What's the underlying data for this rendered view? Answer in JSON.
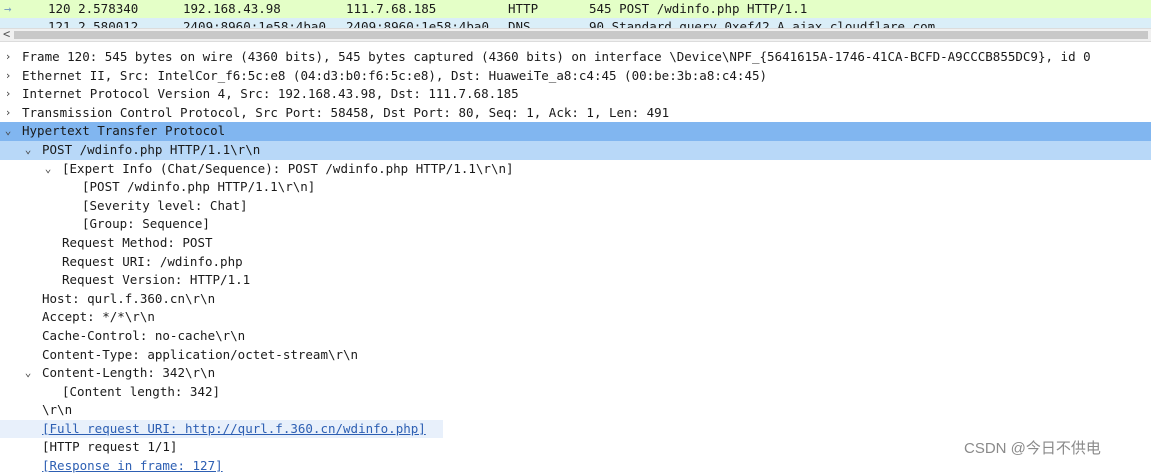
{
  "packet_list": {
    "rows": [
      {
        "no_time": "120 2.578340",
        "src": "192.168.43.98",
        "dst": "111.7.68.185",
        "proto": "HTTP",
        "info": "545 POST /wdinfo.php HTTP/1.1"
      },
      {
        "no_time": "121 2.580012",
        "src": "2409:8960:1e58:4ba0",
        "dst": "2409:8960:1e58:4ba0",
        "proto": "DNS",
        "info": "90 Standard query 0xef42 A ajax.cloudflare.com"
      }
    ]
  },
  "detail": {
    "frame": "Frame 120: 545 bytes on wire (4360 bits), 545 bytes captured (4360 bits) on interface \\Device\\NPF_{5641615A-1746-41CA-BCFD-A9CCCB855DC9}, id 0",
    "ethernet": "Ethernet II, Src: IntelCor_f6:5c:e8 (04:d3:b0:f6:5c:e8), Dst: HuaweiTe_a8:c4:45 (00:be:3b:a8:c4:45)",
    "ip": "Internet Protocol Version 4, Src: 192.168.43.98, Dst: 111.7.68.185",
    "tcp": "Transmission Control Protocol, Src Port: 58458, Dst Port: 80, Seq: 1, Ack: 1, Len: 491",
    "http": "Hypertext Transfer Protocol",
    "request_line": "POST /wdinfo.php HTTP/1.1\\r\\n",
    "expert_info": "[Expert Info (Chat/Sequence): POST /wdinfo.php HTTP/1.1\\r\\n]",
    "expert_post": "[POST /wdinfo.php HTTP/1.1\\r\\n]",
    "severity": "[Severity level: Chat]",
    "group": "[Group: Sequence]",
    "method": "Request Method: POST",
    "uri": "Request URI: /wdinfo.php",
    "version": "Request Version: HTTP/1.1",
    "host": "Host: qurl.f.360.cn\\r\\n",
    "accept": "Accept: */*\\r\\n",
    "cache_control": "Cache-Control: no-cache\\r\\n",
    "content_type": "Content-Type: application/octet-stream\\r\\n",
    "content_length": "Content-Length: 342\\r\\n",
    "content_length_sub": "[Content length: 342]",
    "crlf": "\\r\\n",
    "full_uri": "[Full request URI: http://qurl.f.360.cn/wdinfo.php]",
    "http_request": "[HTTP request 1/1]",
    "response_in": "[Response in frame: 127]"
  },
  "watermark": "CSDN @今日不供电",
  "colors": {
    "packet_row_http": "#e4ffc7",
    "packet_row_dns": "#daeef8",
    "selected_row": "#81b6f0",
    "selected_child": "#b8d8f8",
    "link": "#2d5fb3"
  },
  "icons": {
    "collapsed": "chevron-right-icon",
    "expanded": "chevron-down-icon",
    "scroll_left": "scroll-left-arrow-icon"
  }
}
